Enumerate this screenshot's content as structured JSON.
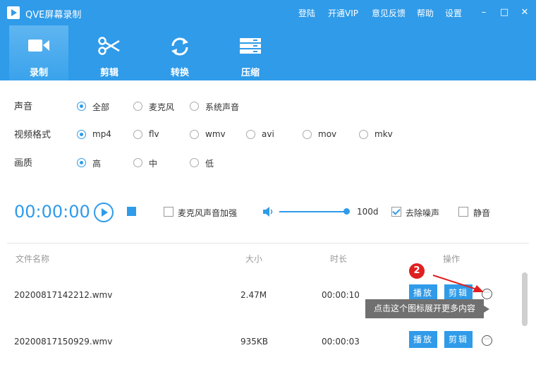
{
  "app": {
    "title": "QVE屏幕录制"
  },
  "toplinks": [
    "登陆",
    "开通VIP",
    "意见反馈",
    "帮助",
    "设置"
  ],
  "window_controls": {
    "minimize": "–",
    "maximize": "□",
    "close": "✕"
  },
  "tools": [
    {
      "label": "录制",
      "icon": "video-camera-icon",
      "active": true
    },
    {
      "label": "剪辑",
      "icon": "scissors-icon",
      "active": false
    },
    {
      "label": "转换",
      "icon": "convert-arrows-icon",
      "active": false
    },
    {
      "label": "压缩",
      "icon": "compress-icon",
      "active": false
    }
  ],
  "settings": {
    "audio": {
      "label": "声音",
      "options": [
        "全部",
        "麦克风",
        "系统声音"
      ],
      "selected": "全部"
    },
    "format": {
      "label": "视频格式",
      "options": [
        "mp4",
        "flv",
        "wmv",
        "avi",
        "mov",
        "mkv"
      ],
      "selected": "mp4"
    },
    "quality": {
      "label": "画质",
      "options": [
        "高",
        "中",
        "低"
      ],
      "selected": "高"
    }
  },
  "recorder": {
    "timer": "00:00:00",
    "mic_boost_label": "麦克风声音加强",
    "mic_boost_checked": false,
    "volume_value": "100d",
    "volume_level": 1.0,
    "denoise_label": "去除噪声",
    "denoise_checked": true,
    "mute_label": "静音",
    "mute_checked": false
  },
  "table": {
    "headers": {
      "name": "文件名称",
      "size": "大小",
      "duration": "时长",
      "actions": "操作"
    },
    "rows": [
      {
        "name": "20200817142212.wmv",
        "size": "2.47M",
        "duration": "00:00:10",
        "play": "播放",
        "edit": "剪辑"
      },
      {
        "name": "20200817150929.wmv",
        "size": "935KB",
        "duration": "00:00:03",
        "play": "播放",
        "edit": "剪辑"
      }
    ]
  },
  "annotation": {
    "badge": "2",
    "tooltip": "点击这个图标展开更多内容",
    "arrow_color": "#e02020"
  },
  "colors": {
    "accent": "#2f9be9",
    "annotation": "#e02020"
  }
}
